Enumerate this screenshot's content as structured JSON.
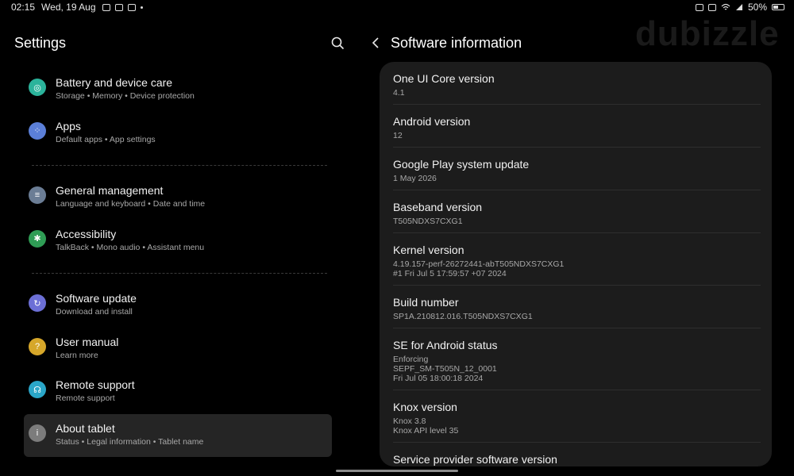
{
  "status_bar": {
    "time": "02:15",
    "date": "Wed, 19 Aug",
    "battery": "50%"
  },
  "watermark": "dubizzle",
  "left": {
    "title": "Settings",
    "items": [
      {
        "title": "Battery and device care",
        "subtitle": "Storage  •  Memory  •  Device protection",
        "icon": "battery-care-icon",
        "color": "#2bb39b"
      },
      {
        "title": "Apps",
        "subtitle": "Default apps  •  App settings",
        "icon": "apps-icon",
        "color": "#5b7fd8"
      },
      {
        "title": "General management",
        "subtitle": "Language and keyboard  •  Date and time",
        "icon": "sliders-icon",
        "color": "#6b7d95"
      },
      {
        "title": "Accessibility",
        "subtitle": "TalkBack  •  Mono audio  •  Assistant menu",
        "icon": "accessibility-icon",
        "color": "#2f9d55"
      },
      {
        "title": "Software update",
        "subtitle": "Download and install",
        "icon": "software-update-icon",
        "color": "#6c6fd6"
      },
      {
        "title": "User manual",
        "subtitle": "Learn more",
        "icon": "user-manual-icon",
        "color": "#d6a72a"
      },
      {
        "title": "Remote support",
        "subtitle": "Remote support",
        "icon": "headset-icon",
        "color": "#2aa6c8"
      },
      {
        "title": "About tablet",
        "subtitle": "Status  •  Legal information  •  Tablet name",
        "icon": "info-icon",
        "color": "#7c7c7c"
      }
    ]
  },
  "right": {
    "title": "Software information",
    "rows": [
      {
        "title": "One UI Core version",
        "values": [
          "4.1"
        ]
      },
      {
        "title": "Android version",
        "values": [
          "12"
        ]
      },
      {
        "title": "Google Play system update",
        "values": [
          "1 May 2026"
        ]
      },
      {
        "title": "Baseband version",
        "values": [
          "T505NDXS7CXG1"
        ]
      },
      {
        "title": "Kernel version",
        "values": [
          "4.19.157-perf-26272441-abT505NDXS7CXG1",
          "#1 Fri Jul 5 17:59:57 +07 2024"
        ]
      },
      {
        "title": "Build number",
        "values": [
          "SP1A.210812.016.T505NDXS7CXG1"
        ]
      },
      {
        "title": "SE for Android status",
        "values": [
          "Enforcing",
          "SEPF_SM-T505N_12_0001",
          "Fri Jul 05 18:00:18 2024"
        ]
      },
      {
        "title": "Knox version",
        "values": [
          "Knox 3.8",
          "Knox API level 35"
        ]
      },
      {
        "title": "Service provider software version",
        "values": []
      }
    ]
  }
}
